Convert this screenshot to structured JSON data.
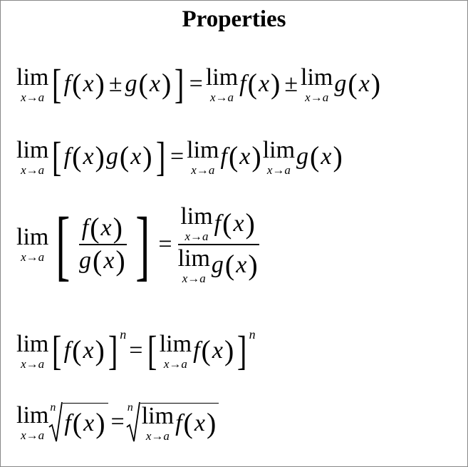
{
  "title": "Properties",
  "lim": "lim",
  "sub": "x→a",
  "f": "f",
  "g": "g",
  "x": "x",
  "n": "n",
  "lp": "(",
  "rp": ")",
  "lb": "[",
  "rb": "]",
  "pm": "±",
  "eq": "="
}
